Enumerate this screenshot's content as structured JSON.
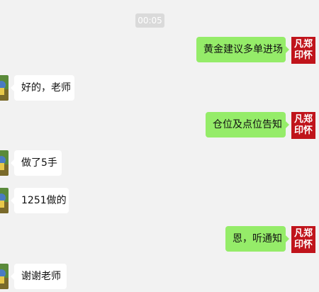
{
  "timestamp": "00:05",
  "teacher_avatar": {
    "line1": "凡郑",
    "line2": "印怀"
  },
  "colors": {
    "background": "#f2f2f2",
    "sent_bubble": "#95ec69",
    "received_bubble": "#ffffff",
    "teacher_avatar": "#c0141b"
  },
  "messages": [
    {
      "side": "right",
      "text": "黄金建议多单进场"
    },
    {
      "side": "left",
      "text": "好的，老师"
    },
    {
      "side": "right",
      "text": "仓位及点位告知"
    },
    {
      "side": "left",
      "text": "做了5手"
    },
    {
      "side": "left",
      "text": "1251做的"
    },
    {
      "side": "right",
      "text": "恩，听通知"
    },
    {
      "side": "left",
      "text": "谢谢老师"
    }
  ]
}
